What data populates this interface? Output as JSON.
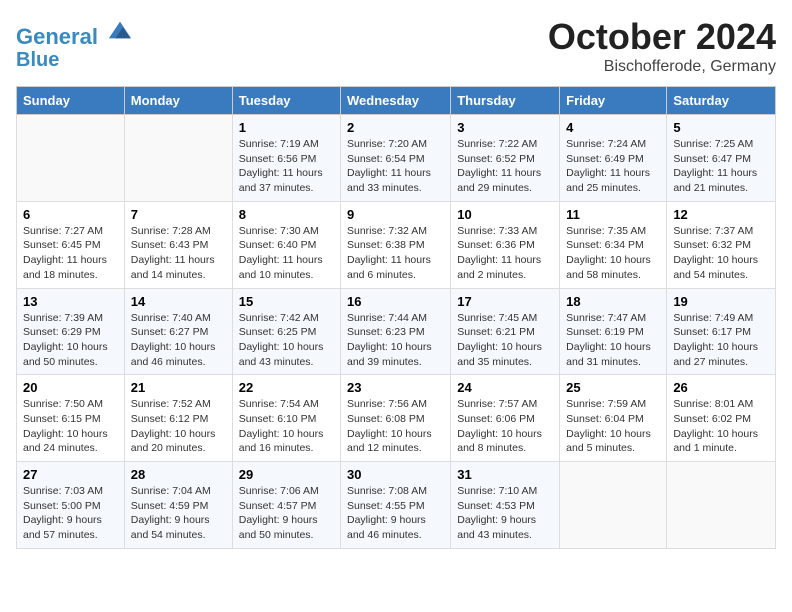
{
  "header": {
    "logo_line1": "General",
    "logo_line2": "Blue",
    "month": "October 2024",
    "location": "Bischofferode, Germany"
  },
  "days_of_week": [
    "Sunday",
    "Monday",
    "Tuesday",
    "Wednesday",
    "Thursday",
    "Friday",
    "Saturday"
  ],
  "weeks": [
    [
      {
        "day": "",
        "info": ""
      },
      {
        "day": "",
        "info": ""
      },
      {
        "day": "1",
        "info": "Sunrise: 7:19 AM\nSunset: 6:56 PM\nDaylight: 11 hours and 37 minutes."
      },
      {
        "day": "2",
        "info": "Sunrise: 7:20 AM\nSunset: 6:54 PM\nDaylight: 11 hours and 33 minutes."
      },
      {
        "day": "3",
        "info": "Sunrise: 7:22 AM\nSunset: 6:52 PM\nDaylight: 11 hours and 29 minutes."
      },
      {
        "day": "4",
        "info": "Sunrise: 7:24 AM\nSunset: 6:49 PM\nDaylight: 11 hours and 25 minutes."
      },
      {
        "day": "5",
        "info": "Sunrise: 7:25 AM\nSunset: 6:47 PM\nDaylight: 11 hours and 21 minutes."
      }
    ],
    [
      {
        "day": "6",
        "info": "Sunrise: 7:27 AM\nSunset: 6:45 PM\nDaylight: 11 hours and 18 minutes."
      },
      {
        "day": "7",
        "info": "Sunrise: 7:28 AM\nSunset: 6:43 PM\nDaylight: 11 hours and 14 minutes."
      },
      {
        "day": "8",
        "info": "Sunrise: 7:30 AM\nSunset: 6:40 PM\nDaylight: 11 hours and 10 minutes."
      },
      {
        "day": "9",
        "info": "Sunrise: 7:32 AM\nSunset: 6:38 PM\nDaylight: 11 hours and 6 minutes."
      },
      {
        "day": "10",
        "info": "Sunrise: 7:33 AM\nSunset: 6:36 PM\nDaylight: 11 hours and 2 minutes."
      },
      {
        "day": "11",
        "info": "Sunrise: 7:35 AM\nSunset: 6:34 PM\nDaylight: 10 hours and 58 minutes."
      },
      {
        "day": "12",
        "info": "Sunrise: 7:37 AM\nSunset: 6:32 PM\nDaylight: 10 hours and 54 minutes."
      }
    ],
    [
      {
        "day": "13",
        "info": "Sunrise: 7:39 AM\nSunset: 6:29 PM\nDaylight: 10 hours and 50 minutes."
      },
      {
        "day": "14",
        "info": "Sunrise: 7:40 AM\nSunset: 6:27 PM\nDaylight: 10 hours and 46 minutes."
      },
      {
        "day": "15",
        "info": "Sunrise: 7:42 AM\nSunset: 6:25 PM\nDaylight: 10 hours and 43 minutes."
      },
      {
        "day": "16",
        "info": "Sunrise: 7:44 AM\nSunset: 6:23 PM\nDaylight: 10 hours and 39 minutes."
      },
      {
        "day": "17",
        "info": "Sunrise: 7:45 AM\nSunset: 6:21 PM\nDaylight: 10 hours and 35 minutes."
      },
      {
        "day": "18",
        "info": "Sunrise: 7:47 AM\nSunset: 6:19 PM\nDaylight: 10 hours and 31 minutes."
      },
      {
        "day": "19",
        "info": "Sunrise: 7:49 AM\nSunset: 6:17 PM\nDaylight: 10 hours and 27 minutes."
      }
    ],
    [
      {
        "day": "20",
        "info": "Sunrise: 7:50 AM\nSunset: 6:15 PM\nDaylight: 10 hours and 24 minutes."
      },
      {
        "day": "21",
        "info": "Sunrise: 7:52 AM\nSunset: 6:12 PM\nDaylight: 10 hours and 20 minutes."
      },
      {
        "day": "22",
        "info": "Sunrise: 7:54 AM\nSunset: 6:10 PM\nDaylight: 10 hours and 16 minutes."
      },
      {
        "day": "23",
        "info": "Sunrise: 7:56 AM\nSunset: 6:08 PM\nDaylight: 10 hours and 12 minutes."
      },
      {
        "day": "24",
        "info": "Sunrise: 7:57 AM\nSunset: 6:06 PM\nDaylight: 10 hours and 8 minutes."
      },
      {
        "day": "25",
        "info": "Sunrise: 7:59 AM\nSunset: 6:04 PM\nDaylight: 10 hours and 5 minutes."
      },
      {
        "day": "26",
        "info": "Sunrise: 8:01 AM\nSunset: 6:02 PM\nDaylight: 10 hours and 1 minute."
      }
    ],
    [
      {
        "day": "27",
        "info": "Sunrise: 7:03 AM\nSunset: 5:00 PM\nDaylight: 9 hours and 57 minutes."
      },
      {
        "day": "28",
        "info": "Sunrise: 7:04 AM\nSunset: 4:59 PM\nDaylight: 9 hours and 54 minutes."
      },
      {
        "day": "29",
        "info": "Sunrise: 7:06 AM\nSunset: 4:57 PM\nDaylight: 9 hours and 50 minutes."
      },
      {
        "day": "30",
        "info": "Sunrise: 7:08 AM\nSunset: 4:55 PM\nDaylight: 9 hours and 46 minutes."
      },
      {
        "day": "31",
        "info": "Sunrise: 7:10 AM\nSunset: 4:53 PM\nDaylight: 9 hours and 43 minutes."
      },
      {
        "day": "",
        "info": ""
      },
      {
        "day": "",
        "info": ""
      }
    ]
  ]
}
